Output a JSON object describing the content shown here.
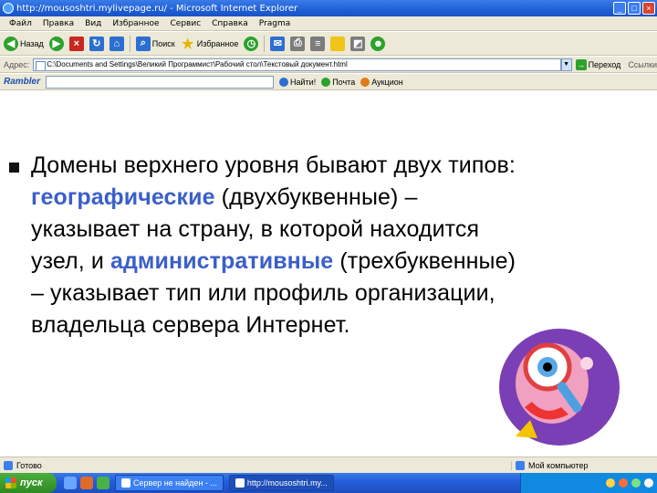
{
  "window": {
    "title": "http://mousoshtri.mylivepage.ru/ - Microsoft Internet Explorer",
    "controls": [
      "_",
      "□",
      "×"
    ]
  },
  "menu": [
    "Файл",
    "Правка",
    "Вид",
    "Избранное",
    "Сервис",
    "Справка",
    "Pragma"
  ],
  "toolbar": {
    "back_label": "Назад",
    "search_label": "Поиск",
    "favorites_label": "Избранное"
  },
  "address": {
    "label": "Адрес:",
    "value": "C:\\Documents and Settings\\Великий Программист\\Рабочий стол\\Текстовый документ.html",
    "go_label": "Переход",
    "links_label": "Ссылки"
  },
  "rambler": {
    "logo": "Rambler",
    "find_label": "Найти!",
    "mail_label": "Почта",
    "auction_label": "Аукцион"
  },
  "content": {
    "line1": "Домены верхнего уровня бывают двух типов:",
    "hl1": "географические",
    "after_hl1": " (двухбуквенные) –",
    "line3": "указывает на страну, в которой находится",
    "line4_before": "узел, и ",
    "hl2": "административные",
    "after_hl2": " (трехбуквенные)",
    "line5": "– указывает тип или профиль организации,",
    "line6": "владельца сервера Интернет."
  },
  "status": {
    "left": "Готово",
    "right": "Мой компьютер"
  },
  "taskbar": {
    "start_label": "пуск",
    "task1": "Сервер не найден - ...",
    "task2": "http://mousoshtri.my..."
  },
  "colors": {
    "highlight": "#3a5fc8",
    "titlebar": "#1f5fd6",
    "chrome": "#ece9d8"
  }
}
